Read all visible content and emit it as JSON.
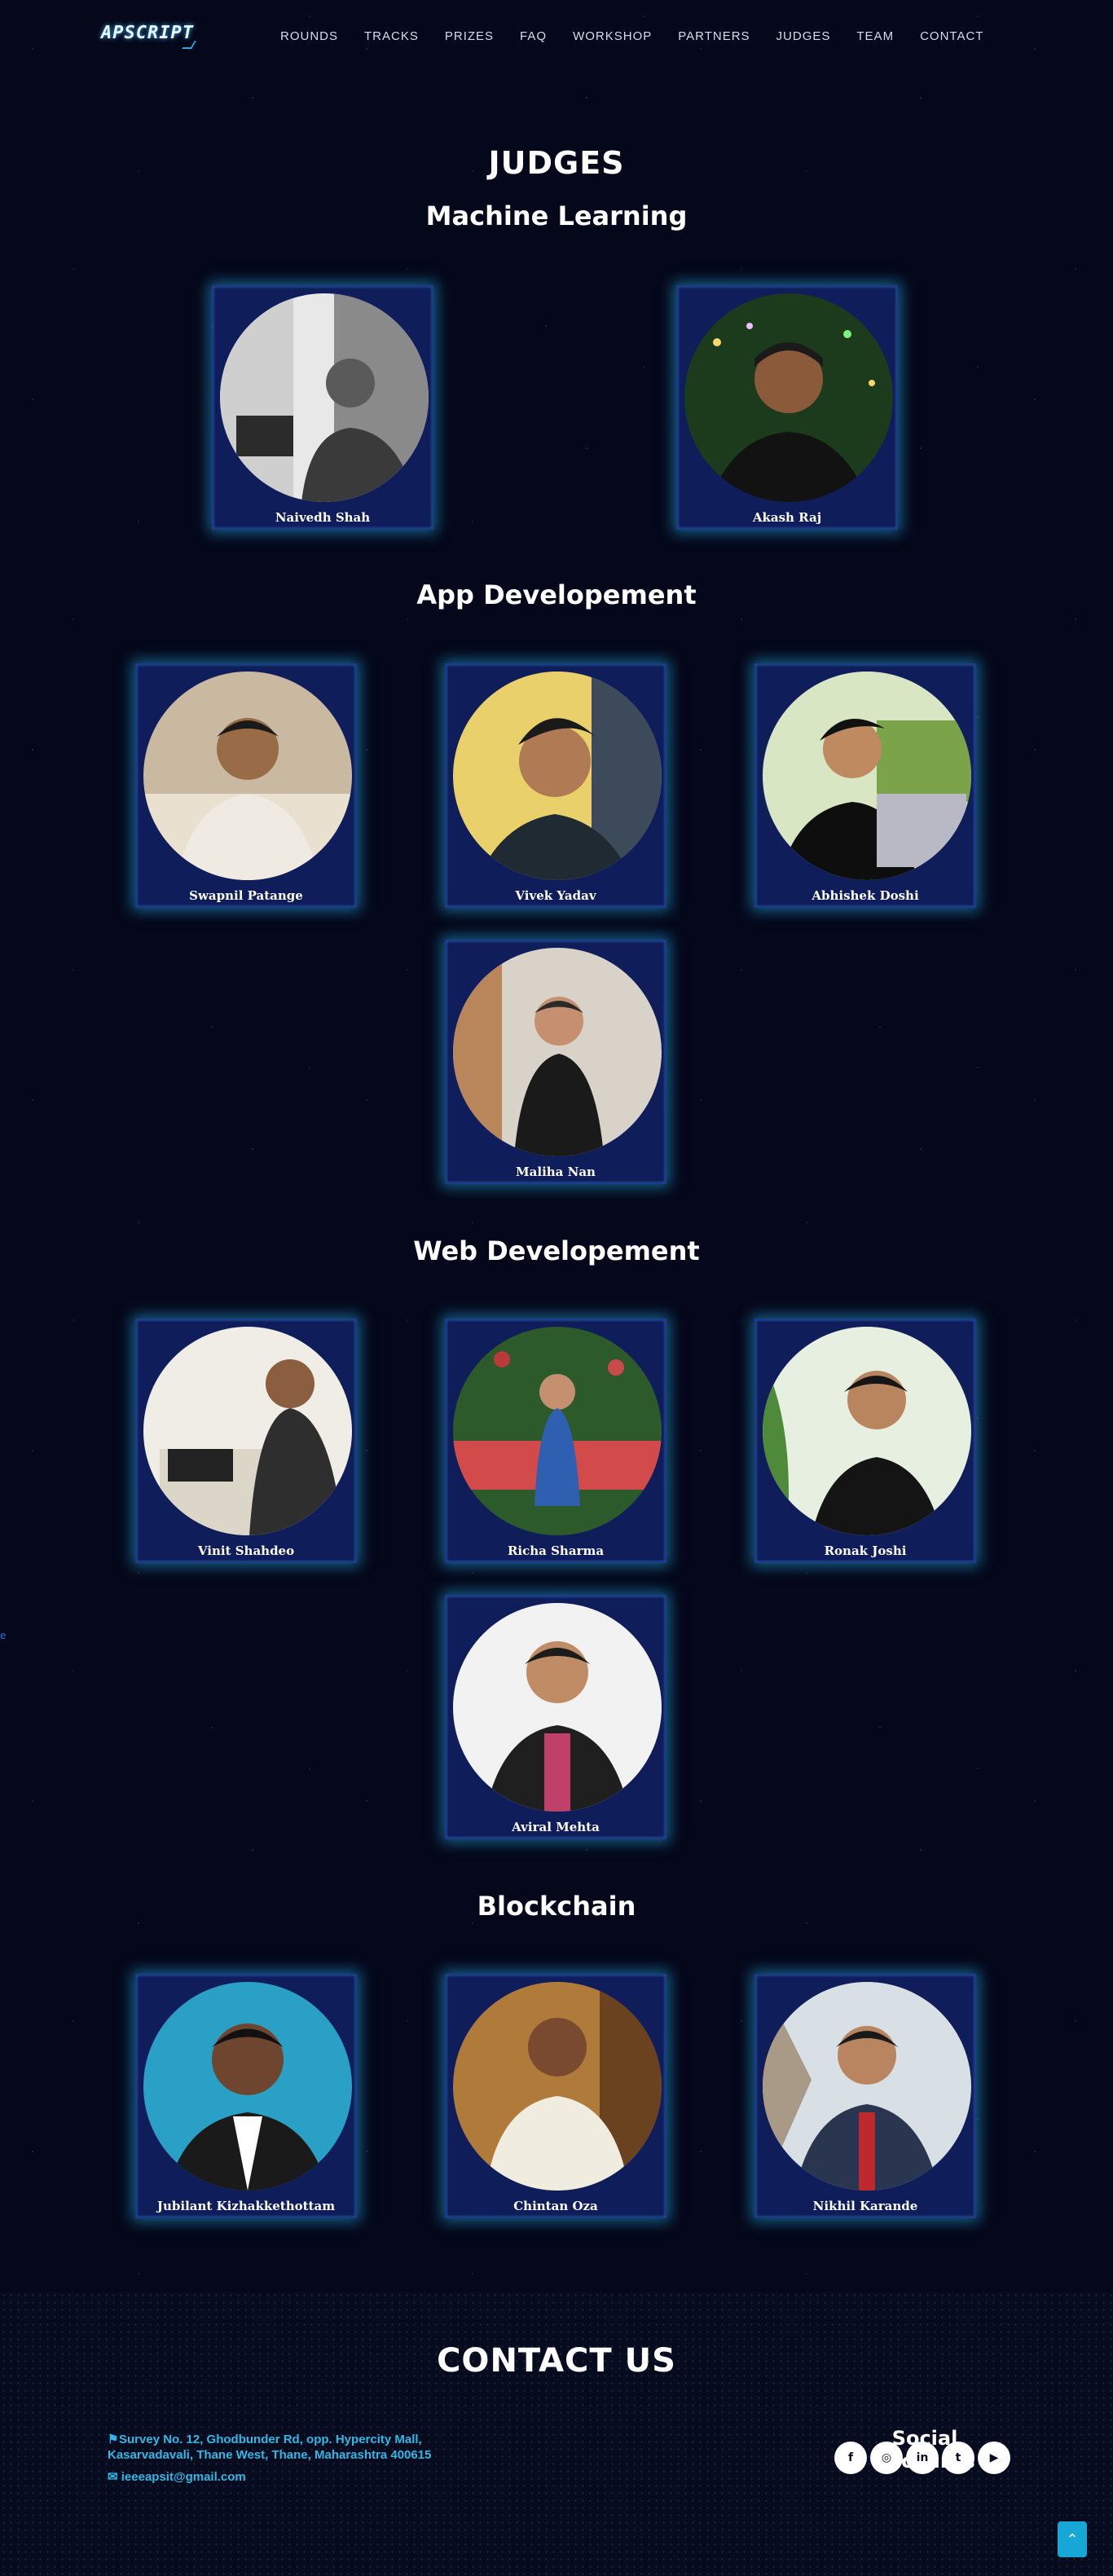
{
  "header": {
    "logo": "APSCRIPT",
    "nav": [
      "ROUNDS",
      "TRACKS",
      "PRIZES",
      "FAQ",
      "WORKSHOP",
      "PARTNERS",
      "JUDGES",
      "TEAM",
      "CONTACT"
    ]
  },
  "judges": {
    "title": "JUDGES",
    "categories": [
      {
        "name": "Machine Learning",
        "judges": [
          "Naivedh Shah",
          "Akash Raj"
        ]
      },
      {
        "name": "App Developement",
        "judges": [
          "Swapnil Patange",
          "Vivek Yadav",
          "Abhishek Doshi",
          "Maliha Nan"
        ]
      },
      {
        "name": "Web Developement",
        "judges": [
          "Vinit Shahdeo",
          "Richa Sharma",
          "Ronak Joshi",
          "Aviral Mehta"
        ]
      },
      {
        "name": "Blockchain",
        "judges": [
          "Jubilant Kizhakkethottam",
          "Chintan Oza",
          "Nikhil Karande"
        ]
      }
    ]
  },
  "contact": {
    "title": "CONTACT US",
    "address_line1": "Survey No. 12, Ghodbunder Rd, opp. Hypercity Mall,",
    "address_line2": "Kasarvadavali, Thane West, Thane, Maharashtra 400615",
    "email": "ieeeapsit@gmail.com",
    "social_title": "Social Accounts",
    "socials": [
      {
        "icon": "facebook-icon",
        "glyph": "f"
      },
      {
        "icon": "instagram-icon",
        "glyph": "◎"
      },
      {
        "icon": "linkedin-icon",
        "glyph": "in"
      },
      {
        "icon": "twitter-icon",
        "glyph": "t"
      },
      {
        "icon": "youtube-icon",
        "glyph": "▶"
      }
    ]
  },
  "back_to_top": "⌃",
  "colors": {
    "background": "#05081a",
    "card": "#0f1d5a",
    "glow": "#20aae6",
    "accent": "#2fb8e6"
  }
}
